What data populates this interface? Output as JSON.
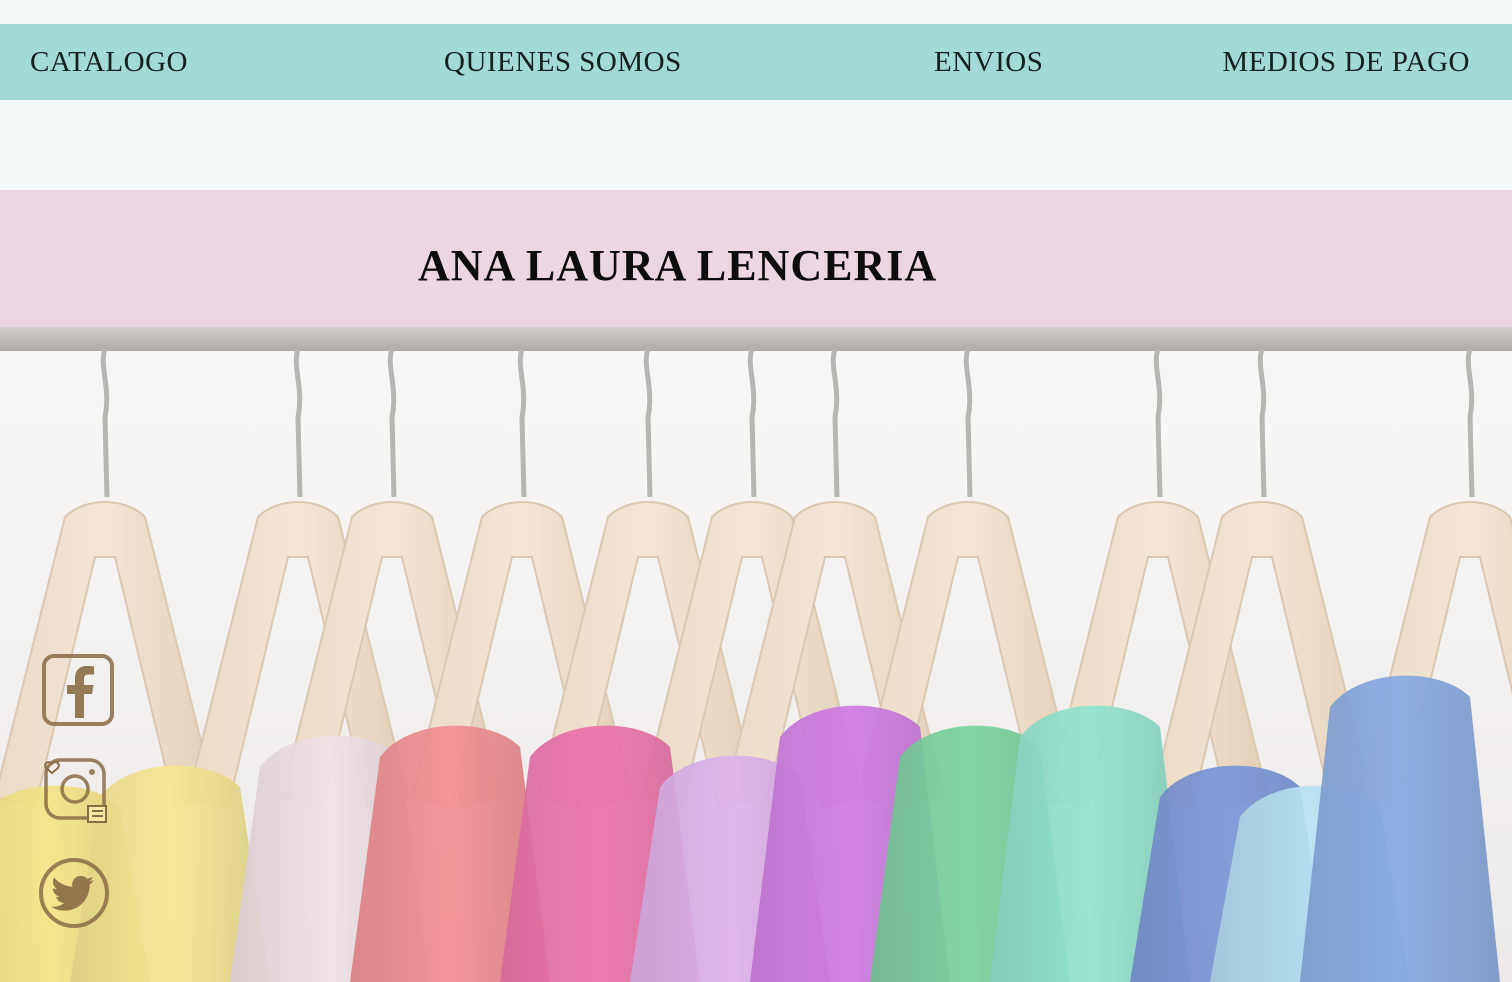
{
  "nav": {
    "items": [
      {
        "label": "CATALOGO"
      },
      {
        "label": "QUIENES SOMOS"
      },
      {
        "label": "ENVIOS"
      },
      {
        "label": "MEDIOS DE PAGO"
      }
    ]
  },
  "header": {
    "title": "ANA LAURA LENCERIA"
  },
  "hero": {
    "image": "clothes-rack-photo",
    "shirt_colors": [
      "#f4de6a",
      "#f6e37a",
      "#eedce3",
      "#f1757a",
      "#e9559a",
      "#d9a3ea",
      "#c55fde",
      "#5ccb8a",
      "#79e0c6",
      "#5c7fd0",
      "#a8dcf0",
      "#6d98dc"
    ]
  },
  "social": {
    "icons": [
      "facebook-icon",
      "instagram-icon",
      "twitter-icon"
    ],
    "color": "#8a6b45"
  },
  "colors": {
    "nav_bg": "#a2dad5",
    "title_band_bg": "#ecd6e2",
    "page_bg": "#f3f9f9"
  }
}
